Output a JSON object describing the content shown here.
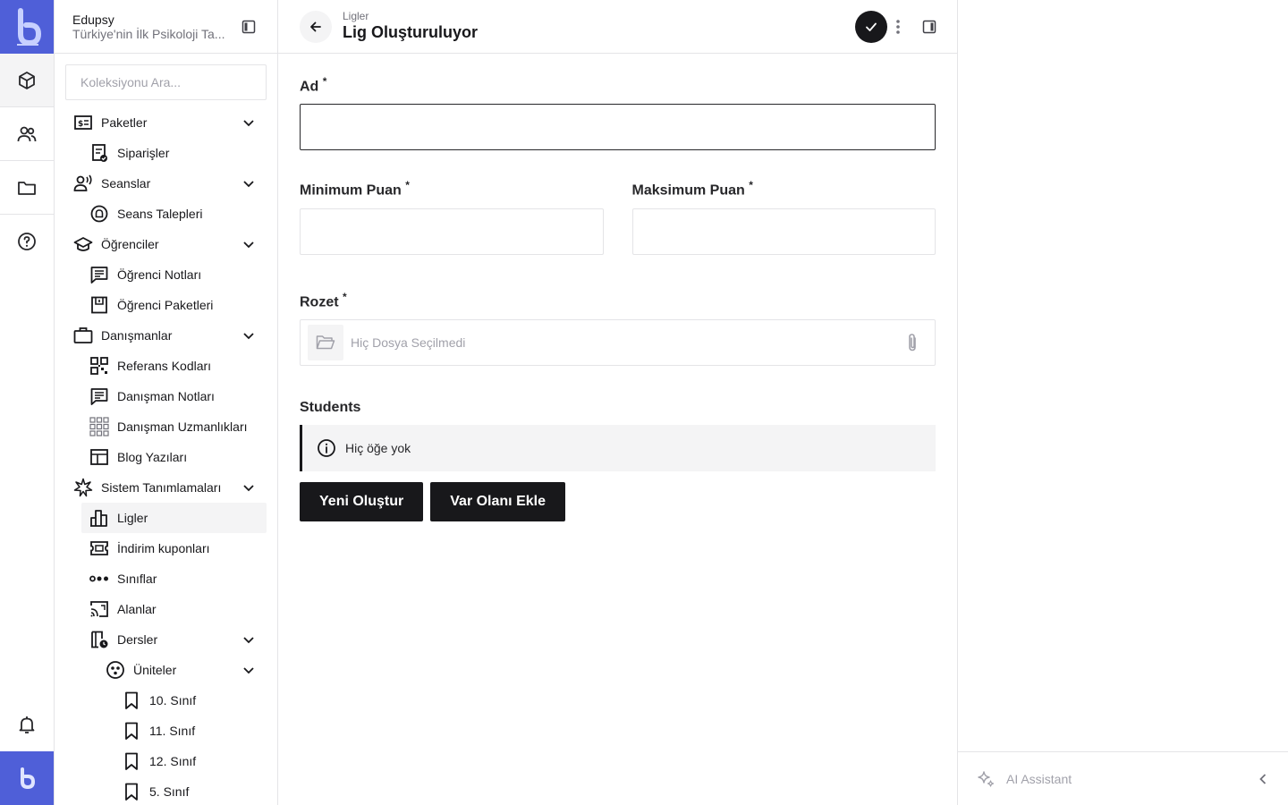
{
  "app": {
    "name": "Edupsy",
    "subtitle": "Türkiye'nin İlk Psikoloji Ta...",
    "search_placeholder": "Koleksiyonu Ara..."
  },
  "sidebar": {
    "items": [
      {
        "label": "Paketler",
        "icon": "package-price-icon"
      },
      {
        "label": "Siparişler",
        "icon": "order-icon"
      },
      {
        "label": "Seanslar",
        "icon": "session-icon"
      },
      {
        "label": "Seans Talepleri",
        "icon": "session-request-icon"
      },
      {
        "label": "Öğrenciler",
        "icon": "graduation-cap-icon"
      },
      {
        "label": "Öğrenci Notları",
        "icon": "notes-icon"
      },
      {
        "label": "Öğrenci Paketleri",
        "icon": "save-box-icon"
      },
      {
        "label": "Danışmanlar",
        "icon": "briefcase-icon"
      },
      {
        "label": "Referans Kodları",
        "icon": "qr-code-icon"
      },
      {
        "label": "Danışman Notları",
        "icon": "notes-icon"
      },
      {
        "label": "Danışman Uzmanlıkları",
        "icon": "grid-icon"
      },
      {
        "label": "Blog Yazıları",
        "icon": "layout-icon"
      },
      {
        "label": "Sistem Tanımlamaları",
        "icon": "sparkle-icon"
      },
      {
        "label": "Ligler",
        "icon": "chart-bar-icon"
      },
      {
        "label": "İndirim kuponları",
        "icon": "coupon-icon"
      },
      {
        "label": "Sınıflar",
        "icon": "dots-icon"
      },
      {
        "label": "Alanlar",
        "icon": "cast-icon"
      },
      {
        "label": "Dersler",
        "icon": "book-clock-icon"
      },
      {
        "label": "Üniteler",
        "icon": "units-icon"
      },
      {
        "label": "10. Sınıf",
        "icon": "bookmark-icon"
      },
      {
        "label": "11. Sınıf",
        "icon": "bookmark-icon"
      },
      {
        "label": "12. Sınıf",
        "icon": "bookmark-icon"
      },
      {
        "label": "5. Sınıf",
        "icon": "bookmark-icon"
      }
    ]
  },
  "header": {
    "breadcrumb": "Ligler",
    "title": "Lig Oluşturuluyor"
  },
  "form": {
    "ad_label": "Ad",
    "ad_value": "",
    "min_label": "Minimum Puan",
    "min_value": "",
    "max_label": "Maksimum Puan",
    "max_value": "",
    "rozet_label": "Rozet",
    "file_placeholder": "Hiç Dosya Seçilmedi",
    "required_mark": "*",
    "students_label": "Students",
    "empty_text": "Hiç öğe yok",
    "create_new": "Yeni Oluştur",
    "add_existing": "Var Olanı Ekle"
  },
  "ai": {
    "label": "AI Assistant"
  },
  "colors": {
    "brand": "#4f5fd8",
    "dark": "#18181b",
    "muted": "#a1a1aa",
    "border": "#e4e4e7"
  }
}
